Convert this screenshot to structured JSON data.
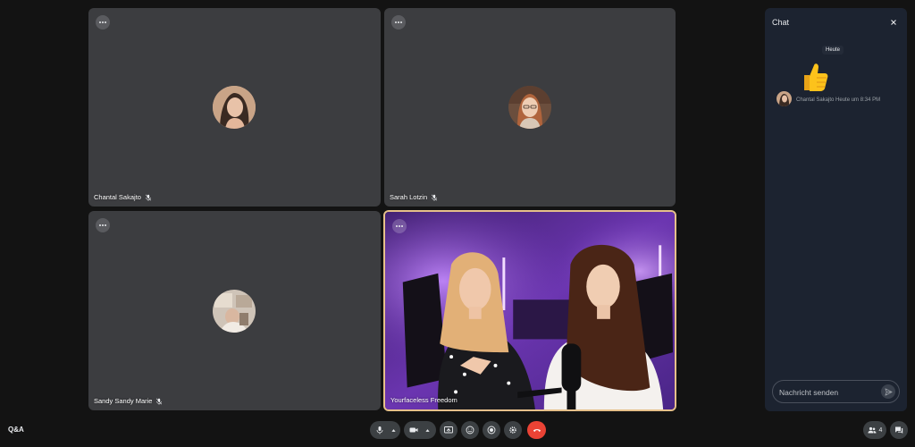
{
  "tiles": [
    {
      "name": "Chantal Sakajto",
      "muted": true
    },
    {
      "name": "Sarah Lotzin",
      "muted": true
    },
    {
      "name": "Sandy Sandy Marie",
      "muted": true
    },
    {
      "name": "Yourfaceless Freedom",
      "muted": false,
      "active": true
    }
  ],
  "chat": {
    "title": "Chat",
    "date_chip": "Heute",
    "messages": [
      {
        "reaction": "thumbs-up",
        "sender": "Chantal Sakajto",
        "timestamp": "Heute um 8:34 PM"
      }
    ],
    "input_placeholder": "Nachricht senden"
  },
  "bottom_bar": {
    "qa_label": "Q&A",
    "participants_count": "4"
  },
  "colors": {
    "tile_bg": "#3c3d40",
    "active_border": "#e6c08a",
    "chat_bg": "#1c2330",
    "hangup": "#ea4335",
    "page_bg": "#131313"
  }
}
